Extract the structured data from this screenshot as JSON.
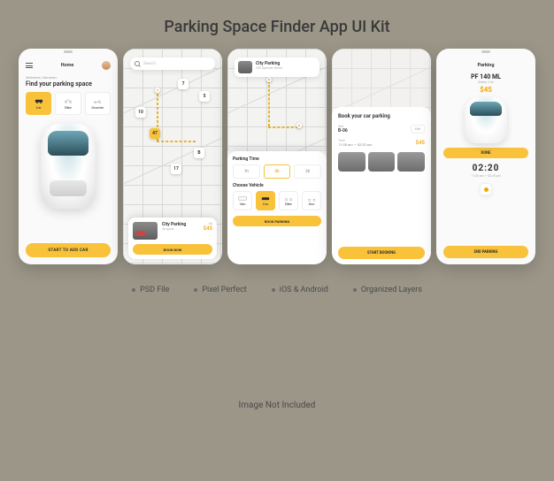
{
  "hero_title": "Parking Space Finder App UI Kit",
  "colors": {
    "accent": "#f8c23a",
    "accent_text": "#f2a500"
  },
  "features": [
    "PSD File",
    "Pixel Perfect",
    "iOS & Android",
    "Organized Layers"
  ],
  "disclaimer": "Image Not Included",
  "screen1": {
    "header": "Home",
    "welcome": "Welcome, Cameron.",
    "title": "Find your parking space",
    "types": [
      {
        "label": "Car",
        "active": true
      },
      {
        "label": "Bike",
        "active": false
      },
      {
        "label": "Scooter",
        "active": false
      }
    ],
    "cta": "START TO ADD CAR"
  },
  "screen2": {
    "search_placeholder": "Search…",
    "pins": [
      "7",
      "5",
      "10",
      "47",
      "B",
      "17"
    ],
    "card": {
      "title": "City Parking",
      "spots": "44 spots",
      "price_label": "/hr",
      "price": "$45",
      "cta": "BOOK NOW"
    }
  },
  "screen3": {
    "top_card": {
      "title": "City Parking",
      "sub": "220 Spooner Street"
    },
    "time_label": "Parking Time",
    "times": [
      "1h",
      "2h",
      "3h"
    ],
    "time_active_index": 1,
    "veh_label": "Choose Vehicle",
    "vehicles": [
      "Van",
      "Car",
      "Bike",
      "Sco"
    ],
    "veh_active_index": 1,
    "cta": "BOOK PARKING"
  },
  "screen4": {
    "title": "Book your car parking",
    "slot_label": "Slot",
    "slot_value": "B-06",
    "time_label": "Time",
    "time_value": "11:00 am — 02:20 pm",
    "price": "$45",
    "edit": "Edit",
    "cta": "START BOOKING"
  },
  "screen5": {
    "header": "Parking",
    "plate": "PF 140 ML",
    "subtitle": "Sedan | Car",
    "price": "$45",
    "done": "DONE",
    "timer": "02:20",
    "timer_sub": "11:00 am — 02:20 pm",
    "end": "END PARKING"
  }
}
